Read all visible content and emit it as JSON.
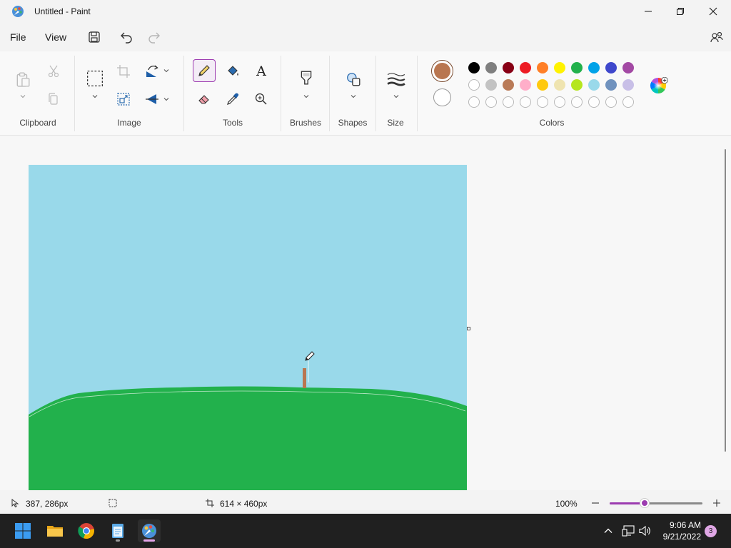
{
  "window": {
    "title": "Untitled - Paint"
  },
  "menu": {
    "file": "File",
    "view": "View"
  },
  "ribbon": {
    "groups": {
      "clipboard": "Clipboard",
      "image": "Image",
      "tools": "Tools",
      "brushes": "Brushes",
      "shapes": "Shapes",
      "size": "Size",
      "colors": "Colors"
    },
    "text_tool_glyph": "A",
    "primary_color": "#b97650",
    "secondary_color": "#ffffff",
    "palette_row1": [
      "#000000",
      "#7f7f7f",
      "#880015",
      "#ed1c24",
      "#ff7f27",
      "#fff200",
      "#22b14c",
      "#00a2e8",
      "#3f48cc",
      "#a349a4"
    ],
    "palette_row2": [
      "#ffffff",
      "#c3c3c3",
      "#b97a57",
      "#ffaec9",
      "#ffc90e",
      "#efe4b0",
      "#b5e61d",
      "#99d9ea",
      "#7092be",
      "#c8bfe7"
    ]
  },
  "canvas": {
    "sky_color": "#99d9ea",
    "grass_color": "#22b14c"
  },
  "status": {
    "cursor_position": "387, 286px",
    "canvas_size": "614 × 460px",
    "zoom": "100%",
    "zoom_level": 0.38
  },
  "taskbar": {
    "time": "9:06 AM",
    "date": "9/21/2022",
    "notification_count": "3"
  }
}
